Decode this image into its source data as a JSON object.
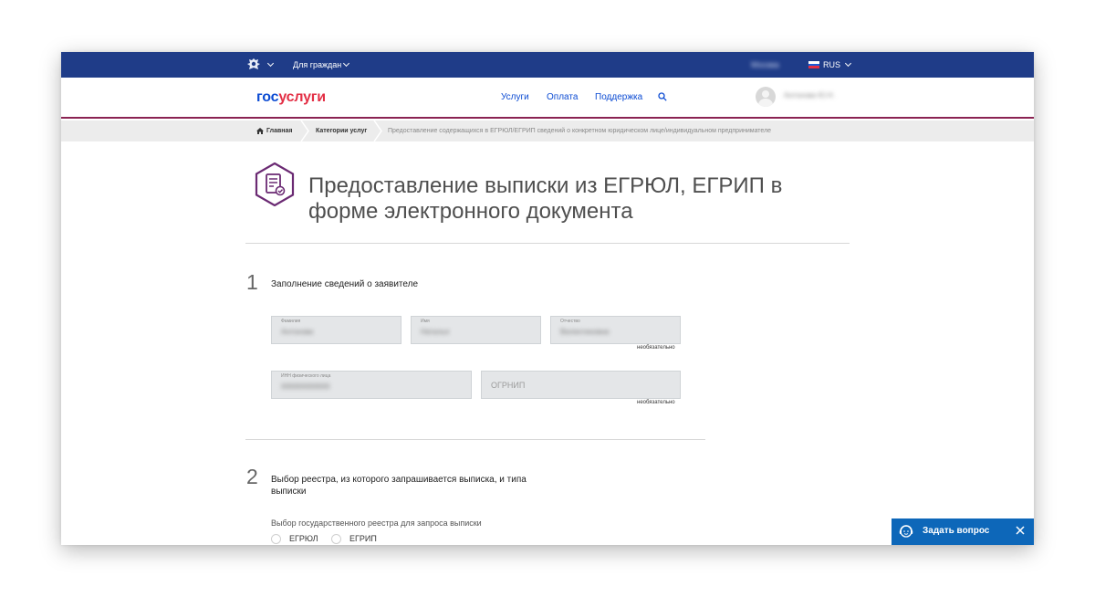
{
  "topbar": {
    "citizens": "Для граждан",
    "location": "Москва",
    "language": "RUS"
  },
  "header": {
    "logo_part1": "гос",
    "logo_part2": "услуги",
    "nav": [
      "Услуги",
      "Оплата",
      "Поддержка"
    ],
    "username": "Антонова Ю.Н."
  },
  "breadcrumb": {
    "home": "Главная",
    "categories": "Категории услуг",
    "current": "Предоставление содержащихся в ЕГРЮЛ/ЕГРИП сведений о конкретном юридическом лице/индивидуальном предпринимателе"
  },
  "page": {
    "title": "Предоставление выписки из ЕГРЮЛ, ЕГРИП в форме электронного документа"
  },
  "step1": {
    "number": "1",
    "title": "Заполнение сведений о заявителе",
    "fields": {
      "lastname": {
        "label": "Фамилия",
        "value": "Антонова"
      },
      "firstname": {
        "label": "Имя",
        "value": "Наталья"
      },
      "patronymic": {
        "label": "Отчество",
        "value": "Валентиновна"
      },
      "inn": {
        "label": "ИНН физического лица",
        "value": "000000000000"
      },
      "ogrnip": {
        "placeholder": "ОГРНИП"
      }
    },
    "optional": "необязательно"
  },
  "step2": {
    "number": "2",
    "title": "Выбор реестра, из которого запрашивается выписка, и типа выписки",
    "registry_label": "Выбор государственного реестра для запроса выписки",
    "options": [
      "ЕГРЮЛ",
      "ЕГРИП"
    ]
  },
  "chat": {
    "label": "Задать вопрос"
  },
  "colors": {
    "topbar": "#1f3c88",
    "accent_purple": "#8a2352",
    "link_blue": "#0d4cd3",
    "logo_red": "#e32f45",
    "chat_button": "#0d67b9"
  }
}
